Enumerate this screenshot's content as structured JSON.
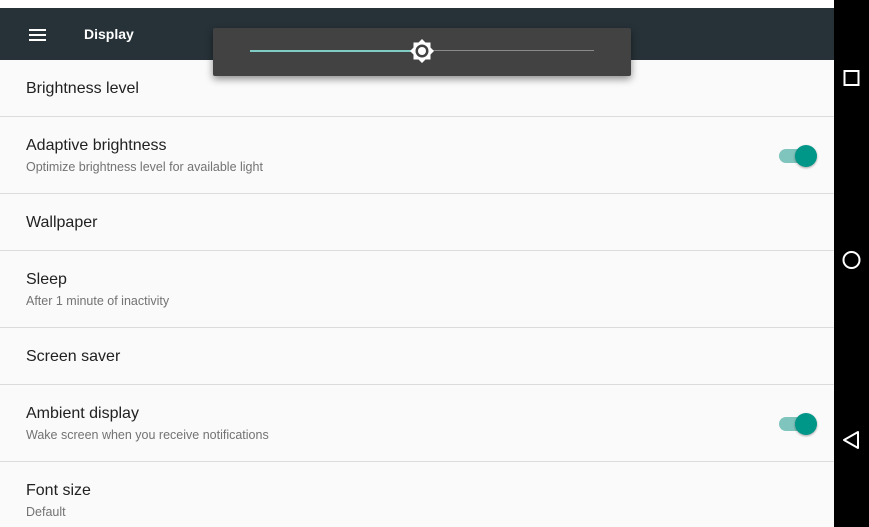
{
  "toolbar": {
    "title": "Display",
    "menu_icon": "menu-icon"
  },
  "brightness_popup": {
    "level": 0.5,
    "icon": "brightness-icon"
  },
  "settings": {
    "brightness_level": {
      "title": "Brightness level"
    },
    "adaptive_brightness": {
      "title": "Adaptive brightness",
      "summary": "Optimize brightness level for available light",
      "enabled": true
    },
    "wallpaper": {
      "title": "Wallpaper"
    },
    "sleep": {
      "title": "Sleep",
      "summary": "After 1 minute of inactivity"
    },
    "screen_saver": {
      "title": "Screen saver"
    },
    "ambient_display": {
      "title": "Ambient display",
      "summary": "Wake screen when you receive notifications",
      "enabled": true
    },
    "font_size": {
      "title": "Font size",
      "summary": "Default"
    }
  },
  "navigation": {
    "recents_icon": "square-icon",
    "home_icon": "circle-icon",
    "back_icon": "back-triangle-icon"
  },
  "colors": {
    "toolbar": "#263238",
    "accent": "#009688",
    "accent_track": "#7fc4bd",
    "popup": "#424242",
    "slider_active": "#80cbc4"
  }
}
